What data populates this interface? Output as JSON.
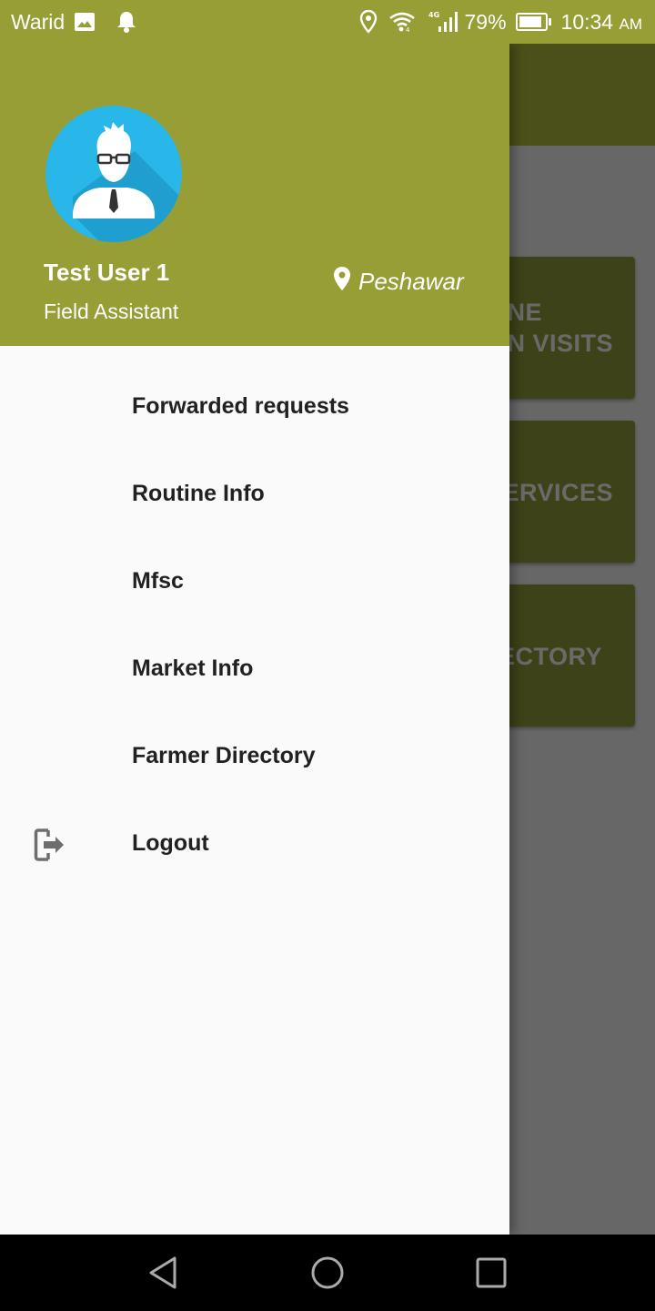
{
  "status_bar": {
    "carrier": "Warid",
    "icons_left": [
      "image-icon",
      "bell-icon"
    ],
    "icons_right": [
      "location-icon",
      "wifi-icon",
      "signal-4g-icon",
      "battery-icon"
    ],
    "network_type": "4G",
    "battery_percent": "79%",
    "time": "10:34",
    "time_suffix": "AM"
  },
  "background_screen": {
    "cards": [
      {
        "label": "NE\nN VISITS"
      },
      {
        "label": "SERVICES"
      },
      {
        "label": "ECTORY"
      }
    ]
  },
  "drawer": {
    "header": {
      "avatar_icon": "user-avatar-icon",
      "user_name": "Test User 1",
      "user_role": "Field Assistant",
      "location_icon": "map-pin-icon",
      "location": "Peshawar"
    },
    "menu": [
      {
        "label": "Forwarded requests",
        "icon": null
      },
      {
        "label": "Routine Info",
        "icon": null
      },
      {
        "label": "Mfsc",
        "icon": null
      },
      {
        "label": "Market Info",
        "icon": null
      },
      {
        "label": "Farmer Directory",
        "icon": null
      },
      {
        "label": "Logout",
        "icon": "logout-icon"
      }
    ]
  },
  "nav_bar": {
    "buttons": [
      "back",
      "home",
      "recents"
    ]
  },
  "colors": {
    "primary": "#969E35",
    "drawer_bg": "#FAFAFA",
    "menu_text": "#212121",
    "avatar_bg": "#29B6E8",
    "icon_grey": "#6E6E6E"
  }
}
